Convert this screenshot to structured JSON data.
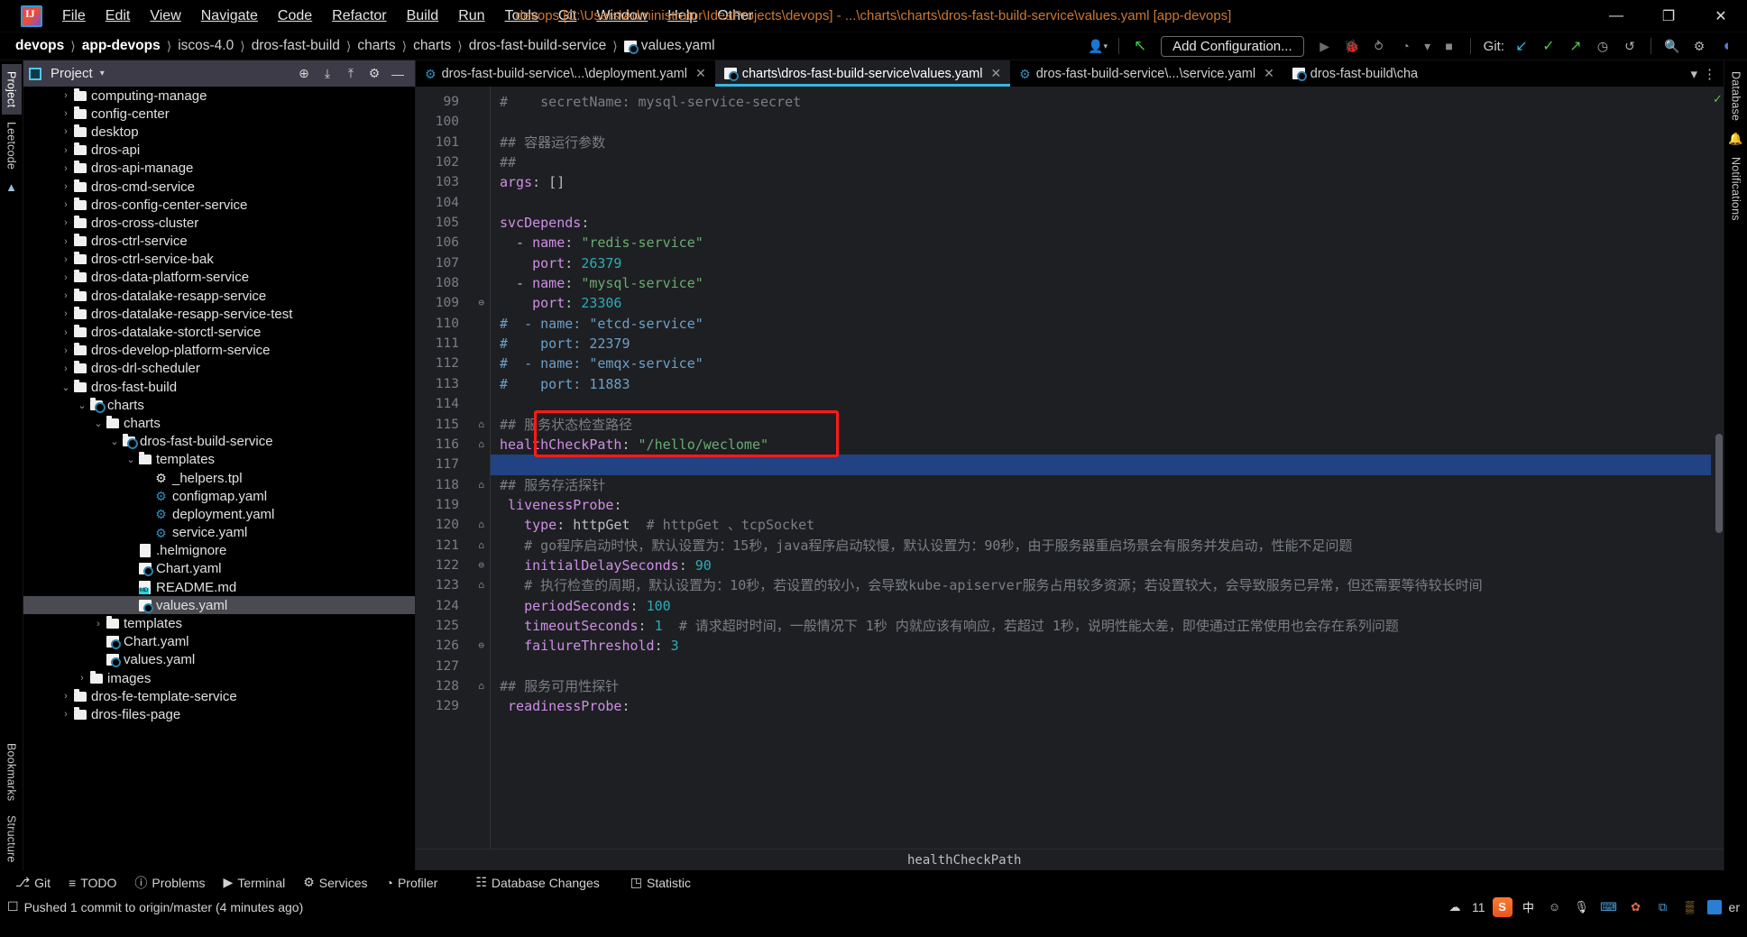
{
  "window": {
    "title": "devops [C:\\Users\\Administrator\\IdeaProjects\\devops] - ...\\charts\\charts\\dros-fast-build-service\\values.yaml [app-devops]",
    "minimize": "—",
    "maximize": "❐",
    "close": "✕"
  },
  "menubar": [
    {
      "label": "File"
    },
    {
      "label": "Edit"
    },
    {
      "label": "View"
    },
    {
      "label": "Navigate"
    },
    {
      "label": "Code"
    },
    {
      "label": "Refactor"
    },
    {
      "label": "Build"
    },
    {
      "label": "Run"
    },
    {
      "label": "Tools"
    },
    {
      "label": "Git"
    },
    {
      "label": "Window"
    },
    {
      "label": "Help"
    },
    {
      "label": "Other"
    }
  ],
  "breadcrumbs": [
    {
      "label": "devops",
      "bold": true
    },
    {
      "label": "app-devops",
      "bold": true
    },
    {
      "label": "iscos-4.0",
      "bold": false
    },
    {
      "label": "dros-fast-build",
      "bold": false
    },
    {
      "label": "charts",
      "bold": false
    },
    {
      "label": "charts",
      "bold": false
    },
    {
      "label": "dros-fast-build-service",
      "bold": false
    },
    {
      "label": "values.yaml",
      "bold": false
    }
  ],
  "toolbar": {
    "add_configuration": "Add Configuration...",
    "git_label": "Git:",
    "run_icon": "▶",
    "debug_icon": "🐞",
    "coverage_icon": "⥁",
    "profile_icon": "◔",
    "dropdown_icon": "▾",
    "stop_icon": "■",
    "update_project_icon": "↙",
    "commit_icon": "✓",
    "push_icon": "↗",
    "history_icon": "◷",
    "rollback_icon": "↺",
    "search_icon": "🔍",
    "settings_icon": "⚙",
    "avatar_icon": "◖",
    "user_icon": "👤",
    "back_icon": "↖"
  },
  "left_rail": [
    {
      "label": "Project",
      "active": true
    },
    {
      "label": "Leetcode",
      "active": false
    }
  ],
  "left_rail_bottom": [
    {
      "label": "Bookmarks"
    },
    {
      "label": "Structure"
    }
  ],
  "right_rail": [
    {
      "label": "Database"
    },
    {
      "label": "Notifications"
    }
  ],
  "project_panel": {
    "title": "Project",
    "caret": "▾",
    "tools": [
      "⊕",
      "⤓",
      "⤒",
      "⚙",
      "—"
    ],
    "tree": [
      {
        "depth": 2,
        "twist": "›",
        "icon": "folder",
        "label": "computing-manage",
        "selected": false
      },
      {
        "depth": 2,
        "twist": "›",
        "icon": "folder",
        "label": "config-center",
        "selected": false
      },
      {
        "depth": 2,
        "twist": "›",
        "icon": "folder",
        "label": "desktop",
        "selected": false
      },
      {
        "depth": 2,
        "twist": "›",
        "icon": "folder",
        "label": "dros-api",
        "selected": false
      },
      {
        "depth": 2,
        "twist": "›",
        "icon": "folder",
        "label": "dros-api-manage",
        "selected": false
      },
      {
        "depth": 2,
        "twist": "›",
        "icon": "folder",
        "label": "dros-cmd-service",
        "selected": false
      },
      {
        "depth": 2,
        "twist": "›",
        "icon": "folder",
        "label": "dros-config-center-service",
        "selected": false
      },
      {
        "depth": 2,
        "twist": "›",
        "icon": "folder",
        "label": "dros-cross-cluster",
        "selected": false
      },
      {
        "depth": 2,
        "twist": "›",
        "icon": "folder",
        "label": "dros-ctrl-service",
        "selected": false
      },
      {
        "depth": 2,
        "twist": "›",
        "icon": "folder",
        "label": "dros-ctrl-service-bak",
        "selected": false
      },
      {
        "depth": 2,
        "twist": "›",
        "icon": "folder",
        "label": "dros-data-platform-service",
        "selected": false
      },
      {
        "depth": 2,
        "twist": "›",
        "icon": "folder",
        "label": "dros-datalake-resapp-service",
        "selected": false
      },
      {
        "depth": 2,
        "twist": "›",
        "icon": "folder",
        "label": "dros-datalake-resapp-service-test",
        "selected": false
      },
      {
        "depth": 2,
        "twist": "›",
        "icon": "folder",
        "label": "dros-datalake-storctl-service",
        "selected": false
      },
      {
        "depth": 2,
        "twist": "›",
        "icon": "folder",
        "label": "dros-develop-platform-service",
        "selected": false
      },
      {
        "depth": 2,
        "twist": "›",
        "icon": "folder",
        "label": "dros-drl-scheduler",
        "selected": false
      },
      {
        "depth": 2,
        "twist": "⌄",
        "icon": "folder",
        "label": "dros-fast-build",
        "selected": false
      },
      {
        "depth": 3,
        "twist": "⌄",
        "icon": "folder-helm",
        "label": "charts",
        "selected": false
      },
      {
        "depth": 4,
        "twist": "⌄",
        "icon": "folder",
        "label": "charts",
        "selected": false
      },
      {
        "depth": 5,
        "twist": "⌄",
        "icon": "folder-helm",
        "label": "dros-fast-build-service",
        "selected": false
      },
      {
        "depth": 6,
        "twist": "⌄",
        "icon": "folder",
        "label": "templates",
        "selected": false
      },
      {
        "depth": 7,
        "twist": "",
        "icon": "gear-grey",
        "label": "_helpers.tpl",
        "selected": false
      },
      {
        "depth": 7,
        "twist": "",
        "icon": "gear",
        "label": "configmap.yaml",
        "selected": false
      },
      {
        "depth": 7,
        "twist": "",
        "icon": "gear",
        "label": "deployment.yaml",
        "selected": false
      },
      {
        "depth": 7,
        "twist": "",
        "icon": "gear",
        "label": "service.yaml",
        "selected": false
      },
      {
        "depth": 6,
        "twist": "",
        "icon": "doc",
        "label": ".helmignore",
        "selected": false
      },
      {
        "depth": 6,
        "twist": "",
        "icon": "yaml",
        "label": "Chart.yaml",
        "selected": false
      },
      {
        "depth": 6,
        "twist": "",
        "icon": "md",
        "label": "README.md",
        "selected": false
      },
      {
        "depth": 6,
        "twist": "",
        "icon": "yaml",
        "label": "values.yaml",
        "selected": true
      },
      {
        "depth": 4,
        "twist": "›",
        "icon": "folder",
        "label": "templates",
        "selected": false
      },
      {
        "depth": 4,
        "twist": "",
        "icon": "yaml",
        "label": "Chart.yaml",
        "selected": false
      },
      {
        "depth": 4,
        "twist": "",
        "icon": "yaml",
        "label": "values.yaml",
        "selected": false
      },
      {
        "depth": 3,
        "twist": "›",
        "icon": "folder",
        "label": "images",
        "selected": false
      },
      {
        "depth": 2,
        "twist": "›",
        "icon": "folder",
        "label": "dros-fe-template-service",
        "selected": false
      },
      {
        "depth": 2,
        "twist": "›",
        "icon": "folder",
        "label": "dros-files-page",
        "selected": false
      }
    ]
  },
  "editor_tabs": [
    {
      "label": "dros-fast-build-service\\...\\deployment.yaml",
      "icon": "gear",
      "active": false,
      "close": "✕"
    },
    {
      "label": "charts\\dros-fast-build-service\\values.yaml",
      "icon": "yaml",
      "active": true,
      "close": "✕"
    },
    {
      "label": "dros-fast-build-service\\...\\service.yaml",
      "icon": "gear",
      "active": false,
      "close": "✕"
    },
    {
      "label": "dros-fast-build\\cha",
      "icon": "yaml",
      "active": false,
      "close": ""
    }
  ],
  "editor_tabs_right": {
    "dropdown": "▾",
    "more": "⋮"
  },
  "code": {
    "first_line": 99,
    "cursor_line": 117,
    "lines": [
      {
        "n": 99,
        "fold": "",
        "html": "<span class='cm'>#    secretName: mysql-service-secret</span>",
        "state": ""
      },
      {
        "n": 100,
        "fold": "",
        "html": "",
        "state": ""
      },
      {
        "n": 101,
        "fold": "",
        "html": "<span class='cm'>## 容器运行参数</span>",
        "state": ""
      },
      {
        "n": 102,
        "fold": "",
        "html": "<span class='cm'>##</span>",
        "state": ""
      },
      {
        "n": 103,
        "fold": "",
        "html": "<span class='key'>args</span><span class='pun'>: []</span>",
        "state": ""
      },
      {
        "n": 104,
        "fold": "",
        "html": "",
        "state": ""
      },
      {
        "n": 105,
        "fold": "",
        "html": "<span class='key'>svcDepends</span><span class='pun'>:</span>",
        "state": ""
      },
      {
        "n": 106,
        "fold": "",
        "html": "<span class='pun'>  - </span><span class='key'>name</span><span class='pun'>: </span><span class='str'>\"redis-service\"</span>",
        "state": ""
      },
      {
        "n": 107,
        "fold": "",
        "html": "<span class='pun'>    </span><span class='key'>port</span><span class='pun'>: </span><span class='num'>26379</span>",
        "state": ""
      },
      {
        "n": 108,
        "fold": "",
        "html": "<span class='pun'>  - </span><span class='key'>name</span><span class='pun'>: </span><span class='str'>\"mysql-service\"</span>",
        "state": ""
      },
      {
        "n": 109,
        "fold": "⊖",
        "html": "<span class='pun'>    </span><span class='key'>port</span><span class='pun'>: </span><span class='num'>23306</span>",
        "state": ""
      },
      {
        "n": 110,
        "fold": "",
        "html": "<span class='cm-cn'>#  - name: \"etcd-service\"</span>",
        "state": ""
      },
      {
        "n": 111,
        "fold": "",
        "html": "<span class='cm-cn'>#    port: 22379</span>",
        "state": ""
      },
      {
        "n": 112,
        "fold": "",
        "html": "<span class='cm-cn'>#  - name: \"emqx-service\"</span>",
        "state": ""
      },
      {
        "n": 113,
        "fold": "",
        "html": "<span class='cm-cn'>#    port: 11883</span>",
        "state": ""
      },
      {
        "n": 114,
        "fold": "",
        "html": "",
        "state": ""
      },
      {
        "n": 115,
        "fold": "⌂",
        "html": "<span class='cm'>## 服务状态检查路径</span>",
        "state": ""
      },
      {
        "n": 116,
        "fold": "⌂",
        "html": "<span class='key'>healthCheckPath</span><span class='pun'>: </span><span class='str'>\"/hello/weclome\"</span>",
        "state": ""
      },
      {
        "n": 117,
        "fold": "",
        "html": "",
        "state": "selected"
      },
      {
        "n": 118,
        "fold": "⌂",
        "html": "<span class='cm'>## 服务存活探针</span>",
        "state": ""
      },
      {
        "n": 119,
        "fold": "",
        "html": "<span class='pun'> </span><span class='key'>livenessProbe</span><span class='pun'>:</span>",
        "state": ""
      },
      {
        "n": 120,
        "fold": "⌂",
        "html": "<span class='pun'>   </span><span class='key'>type</span><span class='pun'>: </span><span class='pun'>httpGet  </span><span class='cm'># httpGet 、tcpSocket</span>",
        "state": ""
      },
      {
        "n": 121,
        "fold": "⌂",
        "html": "<span class='pun'>   </span><span class='cm'># go程序启动时快，默认设置为：15秒，java程序启动较慢，默认设置为：90秒，由于服务器重启场景会有服务并发启动，性能不足问题</span>",
        "state": ""
      },
      {
        "n": 122,
        "fold": "⊖",
        "html": "<span class='pun'>   </span><span class='key'>initialDelaySeconds</span><span class='pun'>: </span><span class='num'>90</span>",
        "state": ""
      },
      {
        "n": 123,
        "fold": "⌂",
        "html": "<span class='pun'>   </span><span class='cm'># 执行检查的周期，默认设置为：10秒，若设置的较小，会导致kube-apiserver服务占用较多资源；若设置较大，会导致服务已异常，但还需要等待较长时间</span>",
        "state": ""
      },
      {
        "n": 124,
        "fold": "",
        "html": "<span class='pun'>   </span><span class='key'>periodSeconds</span><span class='pun'>: </span><span class='num'>100</span>",
        "state": ""
      },
      {
        "n": 125,
        "fold": "",
        "html": "<span class='pun'>   </span><span class='key'>timeoutSeconds</span><span class='pun'>: </span><span class='num'>1</span><span class='pun'>  </span><span class='cm'># 请求超时时间，一般情况下 1秒 内就应该有响应，若超过 1秒，说明性能太差，即使通过正常使用也会存在系列问题</span>",
        "state": ""
      },
      {
        "n": 126,
        "fold": "⊖",
        "html": "<span class='pun'>   </span><span class='key'>failureThreshold</span><span class='pun'>: </span><span class='num'>3</span>",
        "state": ""
      },
      {
        "n": 127,
        "fold": "",
        "html": "",
        "state": ""
      },
      {
        "n": 128,
        "fold": "⌂",
        "html": "<span class='cm'>## 服务可用性探针</span>",
        "state": ""
      },
      {
        "n": 129,
        "fold": "",
        "html": "<span class='pun'> </span><span class='key'>readinessProbe</span><span class='pun'>:</span>",
        "state": ""
      }
    ]
  },
  "editor_breadcrumb": "healthCheckPath",
  "inspection_status": "✓",
  "tool_windows": [
    {
      "label": "Git",
      "icon": "⎇"
    },
    {
      "label": "TODO",
      "icon": "≡"
    },
    {
      "label": "Problems",
      "icon": "ⓘ"
    },
    {
      "label": "Terminal",
      "icon": "▶"
    },
    {
      "label": "Services",
      "icon": "⚙"
    },
    {
      "label": "Profiler",
      "icon": "◔"
    },
    {
      "label": "Database Changes",
      "icon": "☷"
    },
    {
      "label": "Statistic",
      "icon": "◳"
    }
  ],
  "status_bar": {
    "message": "Pushed 1 commit to origin/master (4 minutes ago)",
    "icon": "☐",
    "notification_count": "11",
    "tray": {
      "cloud_icon": "☁",
      "sogou_icon": "S",
      "ime_label": "中",
      "emoji_icon": "☺",
      "mic_icon": "🎙",
      "keyboard_icon": "⌨",
      "box_icon": "⧉",
      "apps_icon": "▒",
      "flower_icon": "✿",
      "trailing_text": "er"
    }
  },
  "colors": {
    "accent_blue": "#3ab6e0",
    "title_orange": "#cc7832",
    "highlight_red": "#ff1a1a",
    "selection_blue": "#214283",
    "editor_bg": "#1e1f22"
  }
}
